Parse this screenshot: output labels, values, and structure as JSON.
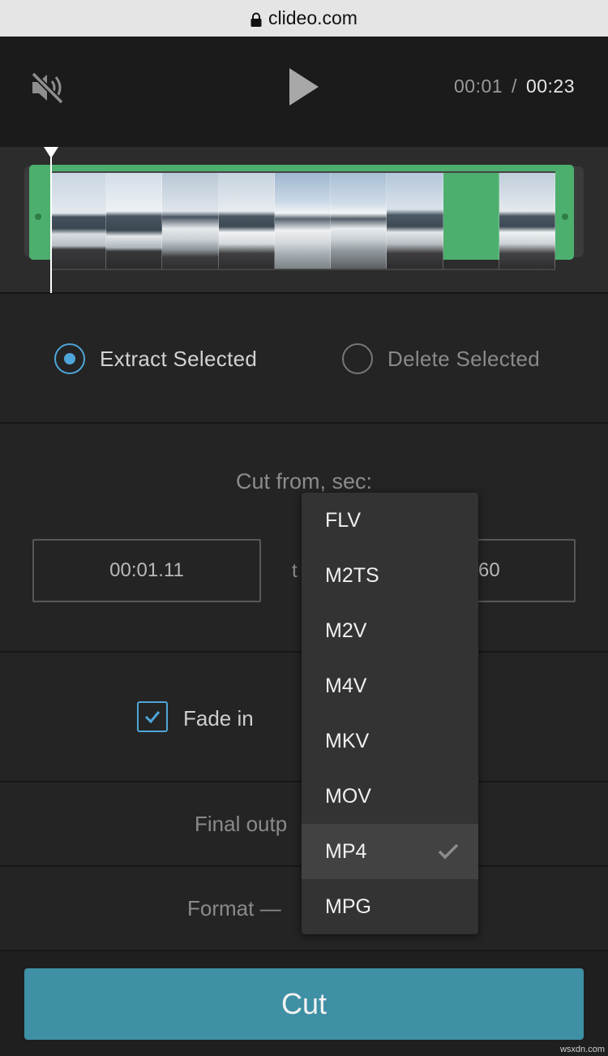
{
  "browser": {
    "url": "clideo.com"
  },
  "player": {
    "current_time": "00:01",
    "separator": "/",
    "total_time": "00:23"
  },
  "mode": {
    "extract_label": "Extract Selected",
    "delete_label": "Delete Selected",
    "selected": "extract"
  },
  "cut": {
    "title": "Cut from, sec:",
    "from_value": "00:01.11",
    "to_label": "t",
    "to_value": "60"
  },
  "fade": {
    "label": "Fade in",
    "checked": true
  },
  "output": {
    "label": "Final outp"
  },
  "format": {
    "label": "Format —"
  },
  "dropdown": {
    "options": [
      "FLV",
      "M2TS",
      "M2V",
      "M4V",
      "MKV",
      "MOV",
      "MP4",
      "MPG"
    ],
    "selected": "MP4"
  },
  "actions": {
    "cut_label": "Cut"
  },
  "watermark": "wsxdn.com",
  "colors": {
    "accent": "#4ea6d8",
    "selection": "#4caf6e",
    "button": "#3f90a5"
  }
}
